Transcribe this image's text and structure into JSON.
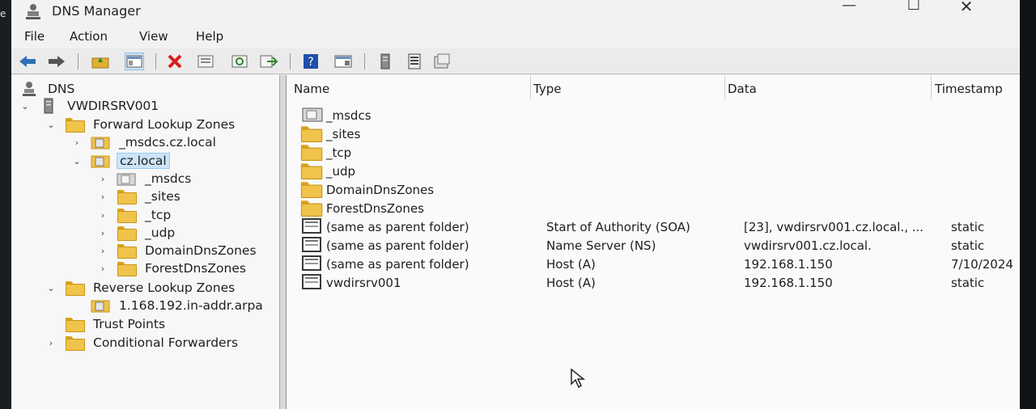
{
  "window": {
    "title": "DNS Manager",
    "edge_char": "e"
  },
  "menu": [
    "File",
    "Action",
    "View",
    "Help"
  ],
  "toolbar": [
    "back-icon",
    "forward-icon",
    "up-folder-icon",
    "console-tree-icon",
    "delete-icon",
    "properties-icon",
    "refresh-icon",
    "export-icon",
    "help-icon",
    "view-icon",
    "server-icon",
    "record-list-icon",
    "zone-icon"
  ],
  "tree": {
    "root": "DNS",
    "server": "VWDIRSRV001",
    "forward": "Forward Lookup Zones",
    "zone_msdcs": "_msdcs.cz.local",
    "zone_cz": "cz.local",
    "sub_msdcs": "_msdcs",
    "sub_sites": "_sites",
    "sub_tcp": "_tcp",
    "sub_udp": "_udp",
    "sub_domaindns": "DomainDnsZones",
    "sub_forestdns": "ForestDnsZones",
    "reverse": "Reverse Lookup Zones",
    "reverse_zone": "1.168.192.in-addr.arpa",
    "trust": "Trust Points",
    "cond": "Conditional Forwarders"
  },
  "list": {
    "columns": [
      "Name",
      "Type",
      "Data",
      "Timestamp"
    ],
    "rows": [
      {
        "name": "_msdcs",
        "type": "",
        "data": "",
        "ts": "",
        "icon": "delegated-zone-icon"
      },
      {
        "name": "_sites",
        "type": "",
        "data": "",
        "ts": "",
        "icon": "folder-icon"
      },
      {
        "name": "_tcp",
        "type": "",
        "data": "",
        "ts": "",
        "icon": "folder-icon"
      },
      {
        "name": "_udp",
        "type": "",
        "data": "",
        "ts": "",
        "icon": "folder-icon"
      },
      {
        "name": "DomainDnsZones",
        "type": "",
        "data": "",
        "ts": "",
        "icon": "folder-icon"
      },
      {
        "name": "ForestDnsZones",
        "type": "",
        "data": "",
        "ts": "",
        "icon": "folder-icon"
      },
      {
        "name": "(same as parent folder)",
        "type": "Start of Authority (SOA)",
        "data": "[23], vwdirsrv001.cz.local., ...",
        "ts": "static",
        "icon": "record-icon"
      },
      {
        "name": "(same as parent folder)",
        "type": "Name Server (NS)",
        "data": "vwdirsrv001.cz.local.",
        "ts": "static",
        "icon": "record-icon"
      },
      {
        "name": "(same as parent folder)",
        "type": "Host (A)",
        "data": "192.168.1.150",
        "ts": "7/10/2024",
        "icon": "record-icon"
      },
      {
        "name": "vwdirsrv001",
        "type": "Host (A)",
        "data": "192.168.1.150",
        "ts": "static",
        "icon": "record-icon"
      }
    ]
  }
}
